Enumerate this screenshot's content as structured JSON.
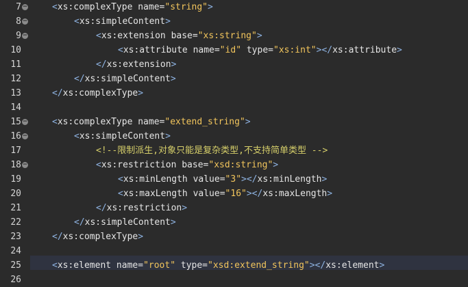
{
  "editor": {
    "lines": [
      {
        "num": "7",
        "fold": true,
        "indent": 1,
        "parts": [
          [
            "bracket",
            "<"
          ],
          [
            "tag",
            "xs:complexType"
          ],
          [
            "attr",
            " name="
          ],
          [
            "str",
            "\"string\""
          ],
          [
            "bracket",
            ">"
          ]
        ]
      },
      {
        "num": "8",
        "fold": true,
        "indent": 2,
        "parts": [
          [
            "bracket",
            "<"
          ],
          [
            "tag",
            "xs:simpleContent"
          ],
          [
            "bracket",
            ">"
          ]
        ]
      },
      {
        "num": "9",
        "fold": true,
        "indent": 3,
        "parts": [
          [
            "bracket",
            "<"
          ],
          [
            "tag",
            "xs:extension"
          ],
          [
            "attr",
            " base="
          ],
          [
            "str",
            "\"xs:string\""
          ],
          [
            "bracket",
            ">"
          ]
        ]
      },
      {
        "num": "10",
        "fold": false,
        "indent": 4,
        "parts": [
          [
            "bracket",
            "<"
          ],
          [
            "tag",
            "xs:attribute"
          ],
          [
            "attr",
            " name="
          ],
          [
            "str",
            "\"id\""
          ],
          [
            "attr",
            " type="
          ],
          [
            "str",
            "\"xs:int\""
          ],
          [
            "bracket",
            "></"
          ],
          [
            "tag",
            "xs:attribute"
          ],
          [
            "bracket",
            ">"
          ]
        ]
      },
      {
        "num": "11",
        "fold": false,
        "indent": 3,
        "parts": [
          [
            "bracket",
            "</"
          ],
          [
            "tag",
            "xs:extension"
          ],
          [
            "bracket",
            ">"
          ]
        ]
      },
      {
        "num": "12",
        "fold": false,
        "indent": 2,
        "parts": [
          [
            "bracket",
            "</"
          ],
          [
            "tag",
            "xs:simpleContent"
          ],
          [
            "bracket",
            ">"
          ]
        ]
      },
      {
        "num": "13",
        "fold": false,
        "indent": 1,
        "parts": [
          [
            "bracket",
            "</"
          ],
          [
            "tag",
            "xs:complexType"
          ],
          [
            "bracket",
            ">"
          ]
        ]
      },
      {
        "num": "14",
        "fold": false,
        "indent": 0,
        "parts": []
      },
      {
        "num": "15",
        "fold": true,
        "indent": 1,
        "parts": [
          [
            "bracket",
            "<"
          ],
          [
            "tag",
            "xs:complexType"
          ],
          [
            "attr",
            " name="
          ],
          [
            "str",
            "\"extend_string\""
          ],
          [
            "bracket",
            ">"
          ]
        ]
      },
      {
        "num": "16",
        "fold": true,
        "indent": 2,
        "parts": [
          [
            "bracket",
            "<"
          ],
          [
            "tag",
            "xs:simpleContent"
          ],
          [
            "bracket",
            ">"
          ]
        ]
      },
      {
        "num": "17",
        "fold": false,
        "indent": 3,
        "parts": [
          [
            "comment",
            "<!--限制派生,对象只能是复杂类型,不支持简单类型 -->"
          ]
        ]
      },
      {
        "num": "18",
        "fold": true,
        "indent": 3,
        "parts": [
          [
            "bracket",
            "<"
          ],
          [
            "tag",
            "xs:restriction"
          ],
          [
            "attr",
            " base="
          ],
          [
            "str",
            "\"xsd:string\""
          ],
          [
            "bracket",
            ">"
          ]
        ]
      },
      {
        "num": "19",
        "fold": false,
        "indent": 4,
        "parts": [
          [
            "bracket",
            "<"
          ],
          [
            "tag",
            "xs:minLength"
          ],
          [
            "attr",
            " value="
          ],
          [
            "str",
            "\"3\""
          ],
          [
            "bracket",
            "></"
          ],
          [
            "tag",
            "xs:minLength"
          ],
          [
            "bracket",
            ">"
          ]
        ]
      },
      {
        "num": "20",
        "fold": false,
        "indent": 4,
        "parts": [
          [
            "bracket",
            "<"
          ],
          [
            "tag",
            "xs:maxLength"
          ],
          [
            "attr",
            " value="
          ],
          [
            "str",
            "\"16\""
          ],
          [
            "bracket",
            "></"
          ],
          [
            "tag",
            "xs:maxLength"
          ],
          [
            "bracket",
            ">"
          ]
        ]
      },
      {
        "num": "21",
        "fold": false,
        "indent": 3,
        "parts": [
          [
            "bracket",
            "</"
          ],
          [
            "tag",
            "xs:restriction"
          ],
          [
            "bracket",
            ">"
          ]
        ]
      },
      {
        "num": "22",
        "fold": false,
        "indent": 2,
        "parts": [
          [
            "bracket",
            "</"
          ],
          [
            "tag",
            "xs:simpleContent"
          ],
          [
            "bracket",
            ">"
          ]
        ]
      },
      {
        "num": "23",
        "fold": false,
        "indent": 1,
        "parts": [
          [
            "bracket",
            "</"
          ],
          [
            "tag",
            "xs:complexType"
          ],
          [
            "bracket",
            ">"
          ]
        ]
      },
      {
        "num": "24",
        "fold": false,
        "indent": 0,
        "parts": []
      },
      {
        "num": "25",
        "fold": false,
        "indent": 1,
        "parts": [
          [
            "bracket",
            "<"
          ],
          [
            "tag",
            "xs:element"
          ],
          [
            "attr",
            " name="
          ],
          [
            "str",
            "\"root\""
          ],
          [
            "attr",
            " type="
          ],
          [
            "str",
            "\"xsd:extend_string\""
          ],
          [
            "bracket",
            "></"
          ],
          [
            "tag",
            "xs:element"
          ],
          [
            "bracket",
            ">"
          ]
        ]
      },
      {
        "num": "26",
        "fold": false,
        "indent": 0,
        "parts": []
      }
    ]
  }
}
